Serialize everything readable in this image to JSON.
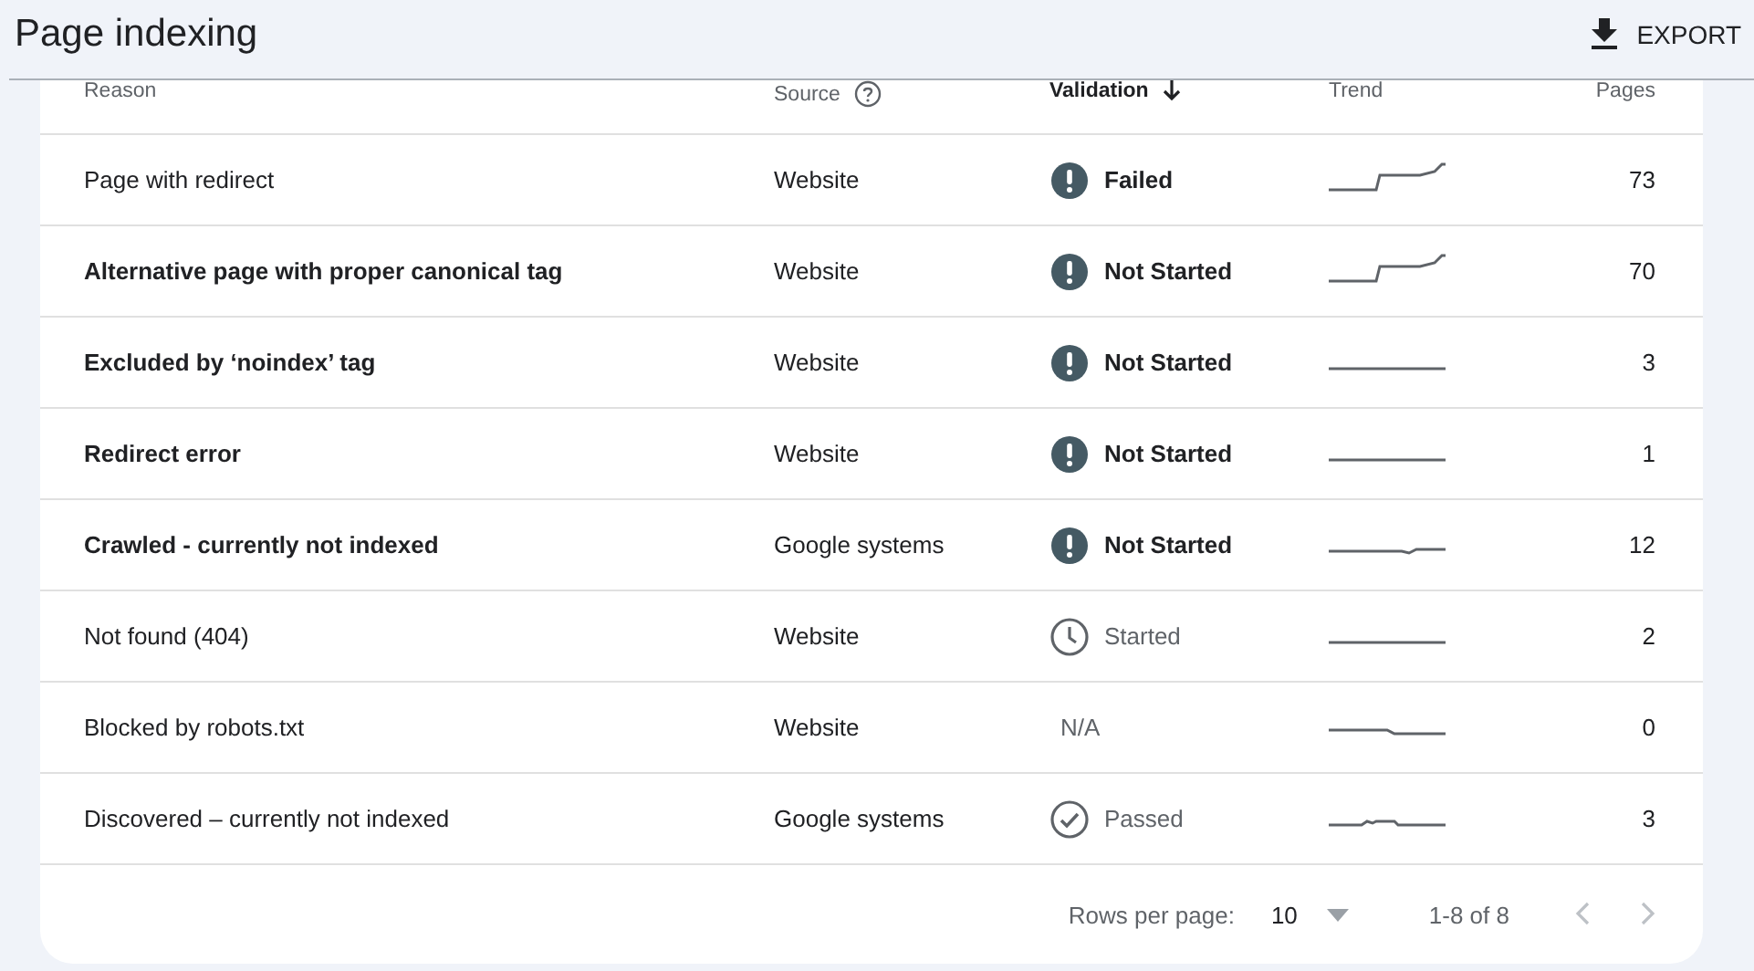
{
  "header": {
    "title": "Page indexing",
    "export_label": "EXPORT"
  },
  "table": {
    "columns": [
      {
        "label": "Reason",
        "kind": "plain"
      },
      {
        "label": "Source",
        "kind": "help"
      },
      {
        "label": "Validation",
        "kind": "sorted"
      },
      {
        "label": "Trend",
        "kind": "plain"
      },
      {
        "label": "Pages",
        "kind": "plain"
      }
    ],
    "rows": [
      {
        "reason": "Page with redirect",
        "bold": false,
        "source": "Website",
        "validation": {
          "kind": "alert",
          "label": "Failed"
        },
        "trend": {
          "kind": "rise"
        },
        "pages": "73"
      },
      {
        "reason": "Alternative page with proper canonical tag",
        "bold": true,
        "source": "Website",
        "validation": {
          "kind": "alert",
          "label": "Not Started"
        },
        "trend": {
          "kind": "rise"
        },
        "pages": "70"
      },
      {
        "reason": "Excluded by ‘noindex’ tag",
        "bold": true,
        "source": "Website",
        "validation": {
          "kind": "alert",
          "label": "Not Started"
        },
        "trend": {
          "kind": "flat"
        },
        "pages": "3"
      },
      {
        "reason": "Redirect error",
        "bold": true,
        "source": "Website",
        "validation": {
          "kind": "alert",
          "label": "Not Started"
        },
        "trend": {
          "kind": "flat"
        },
        "pages": "1"
      },
      {
        "reason": "Crawled - currently not indexed",
        "bold": true,
        "source": "Google systems",
        "validation": {
          "kind": "alert",
          "label": "Not Started"
        },
        "trend": {
          "kind": "wiggle"
        },
        "pages": "12"
      },
      {
        "reason": "Not found (404)",
        "bold": false,
        "source": "Website",
        "validation": {
          "kind": "clock",
          "label": "Started"
        },
        "trend": {
          "kind": "flat"
        },
        "pages": "2"
      },
      {
        "reason": "Blocked by robots.txt",
        "bold": false,
        "source": "Website",
        "validation": {
          "kind": "none",
          "label": "N/A"
        },
        "trend": {
          "kind": "drop"
        },
        "pages": "0"
      },
      {
        "reason": "Discovered – currently not indexed",
        "bold": false,
        "source": "Google systems",
        "validation": {
          "kind": "check",
          "label": "Passed"
        },
        "trend": {
          "kind": "bump"
        },
        "pages": "3"
      }
    ]
  },
  "pagination": {
    "rows_label": "Rows per page:",
    "rows_value": "10",
    "range": "1-8 of 8"
  }
}
